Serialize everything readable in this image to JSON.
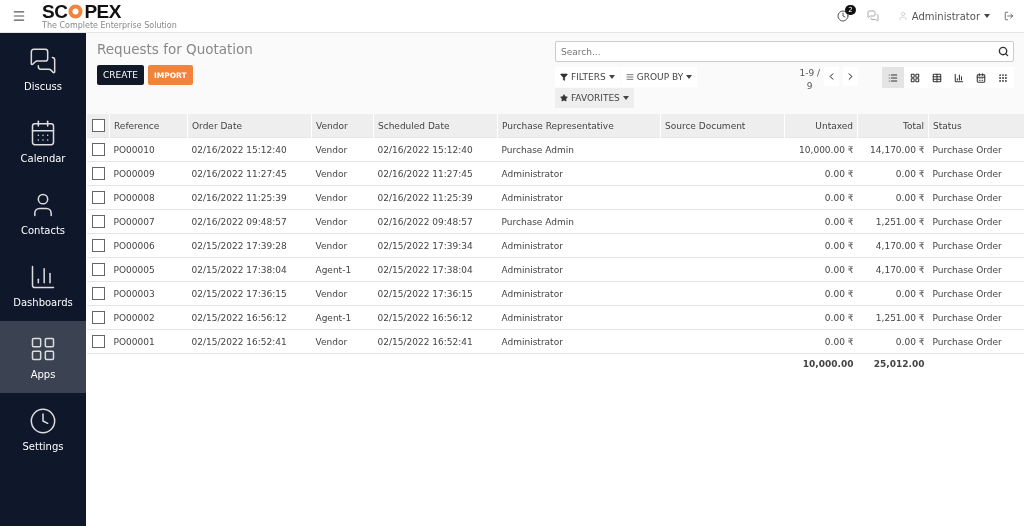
{
  "logo": {
    "start": "SC",
    "end": "PEX",
    "tagline": "The Complete Enterprise Solution"
  },
  "topbar": {
    "activity_badge": "2",
    "user": "Administrator"
  },
  "sidebar": {
    "items": [
      {
        "label": "Discuss",
        "selected": false
      },
      {
        "label": "Calendar",
        "selected": false
      },
      {
        "label": "Contacts",
        "selected": false
      },
      {
        "label": "Dashboards",
        "selected": false
      },
      {
        "label": "Apps",
        "selected": true
      },
      {
        "label": "Settings",
        "selected": false
      }
    ]
  },
  "breadcrumb": "Requests for Quotation",
  "buttons": {
    "create": "CREATE",
    "import": "IMPORT"
  },
  "search": {
    "placeholder": "Search..."
  },
  "filters": [
    "FILTERS",
    "GROUP BY",
    "FAVORITES"
  ],
  "pager": {
    "range": "1-9 /",
    "total": "9"
  },
  "views": [
    {
      "kind": "list",
      "selected": true
    },
    {
      "kind": "kanban",
      "selected": false
    },
    {
      "kind": "pivot",
      "selected": false
    },
    {
      "kind": "graph",
      "selected": false
    },
    {
      "kind": "calendar",
      "selected": false
    },
    {
      "kind": "grid",
      "selected": false
    }
  ],
  "table": {
    "all_selected": false,
    "columns": [
      "Reference",
      "Order Date",
      "Vendor",
      "Scheduled Date",
      "Purchase Representative",
      "Source Document",
      "Untaxed",
      "Total",
      "Status"
    ],
    "rows": [
      {
        "checked": false,
        "cells": [
          "PO00010",
          "02/16/2022 15:12:40",
          "Vendor",
          "02/16/2022 15:12:40",
          "Purchase Admin",
          "",
          "10,000.00 ₹",
          "14,170.00 ₹",
          "Purchase Order"
        ]
      },
      {
        "checked": false,
        "cells": [
          "PO00009",
          "02/16/2022 11:27:45",
          "Vendor",
          "02/16/2022 11:27:45",
          "Administrator",
          "",
          "0.00 ₹",
          "0.00 ₹",
          "Purchase Order"
        ]
      },
      {
        "checked": false,
        "cells": [
          "PO00008",
          "02/16/2022 11:25:39",
          "Vendor",
          "02/16/2022 11:25:39",
          "Administrator",
          "",
          "0.00 ₹",
          "0.00 ₹",
          "Purchase Order"
        ]
      },
      {
        "checked": false,
        "cells": [
          "PO00007",
          "02/16/2022 09:48:57",
          "Vendor",
          "02/16/2022 09:48:57",
          "Purchase Admin",
          "",
          "0.00 ₹",
          "1,251.00 ₹",
          "Purchase Order"
        ]
      },
      {
        "checked": false,
        "cells": [
          "PO00006",
          "02/15/2022 17:39:28",
          "Vendor",
          "02/15/2022 17:39:34",
          "Administrator",
          "",
          "0.00 ₹",
          "4,170.00 ₹",
          "Purchase Order"
        ]
      },
      {
        "checked": false,
        "cells": [
          "PO00005",
          "02/15/2022 17:38:04",
          "Agent-1",
          "02/15/2022 17:38:04",
          "Administrator",
          "",
          "0.00 ₹",
          "4,170.00 ₹",
          "Purchase Order"
        ]
      },
      {
        "checked": false,
        "cells": [
          "PO00003",
          "02/15/2022 17:36:15",
          "Vendor",
          "02/15/2022 17:36:15",
          "Administrator",
          "",
          "0.00 ₹",
          "0.00 ₹",
          "Purchase Order"
        ]
      },
      {
        "checked": false,
        "cells": [
          "PO00002",
          "02/15/2022 16:56:12",
          "Agent-1",
          "02/15/2022 16:56:12",
          "Administrator",
          "",
          "0.00 ₹",
          "1,251.00 ₹",
          "Purchase Order"
        ]
      },
      {
        "checked": false,
        "cells": [
          "PO00001",
          "02/15/2022 16:52:41",
          "Vendor",
          "02/15/2022 16:52:41",
          "Administrator",
          "",
          "0.00 ₹",
          "0.00 ₹",
          "Purchase Order"
        ]
      }
    ],
    "totals": {
      "untaxed": "10,000.00",
      "total": "25,012.00"
    }
  }
}
